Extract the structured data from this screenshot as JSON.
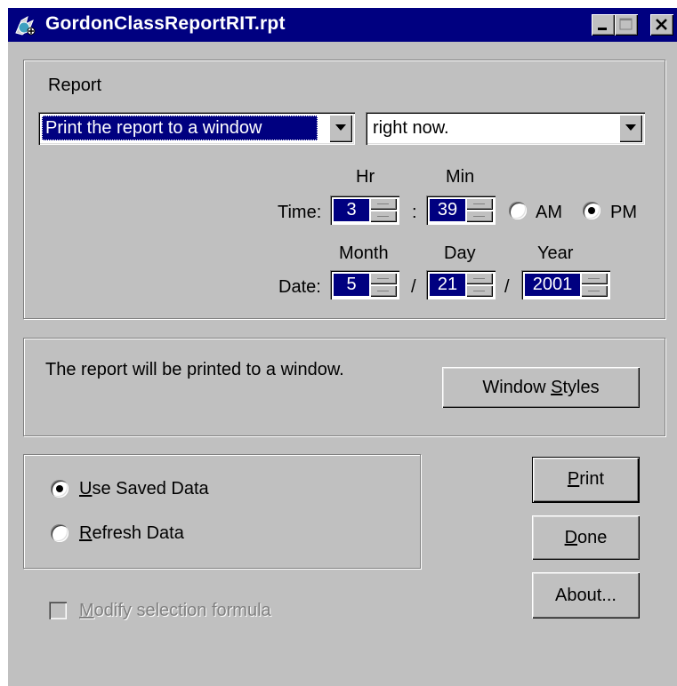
{
  "window": {
    "title": "GordonClassReportRIT.rpt",
    "colors": {
      "titlebar": "#000080",
      "face": "#c0c0c0",
      "selection": "#000080"
    }
  },
  "report": {
    "label": "Report",
    "destination": "Print the report to a window",
    "timing": "right now.",
    "time": {
      "label": "Time:",
      "hr_label": "Hr",
      "min_label": "Min",
      "hr": "3",
      "separator": ":",
      "min": "39",
      "am_label": "AM",
      "pm_label": "PM",
      "selected_period": "PM"
    },
    "date": {
      "label": "Date:",
      "month_label": "Month",
      "day_label": "Day",
      "year_label": "Year",
      "month": "5",
      "day": "21",
      "year": "2001",
      "separator": "/"
    }
  },
  "output": {
    "message": "The report will be printed to a window.",
    "window_styles_prefix": "Window ",
    "window_styles_mnemonic": "S",
    "window_styles_suffix": "tyles"
  },
  "data_source": {
    "use_saved_mnemonic": "U",
    "use_saved_rest": "se Saved Data",
    "refresh_mnemonic": "R",
    "refresh_rest": "efresh Data",
    "selected": "Use Saved Data"
  },
  "modify_selection": {
    "mnemonic": "M",
    "rest": "odify selection formula",
    "checked": false,
    "enabled": false
  },
  "buttons": {
    "print_mnemonic": "P",
    "print_rest": "rint",
    "done_mnemonic": "D",
    "done_rest": "one",
    "about": "About..."
  }
}
